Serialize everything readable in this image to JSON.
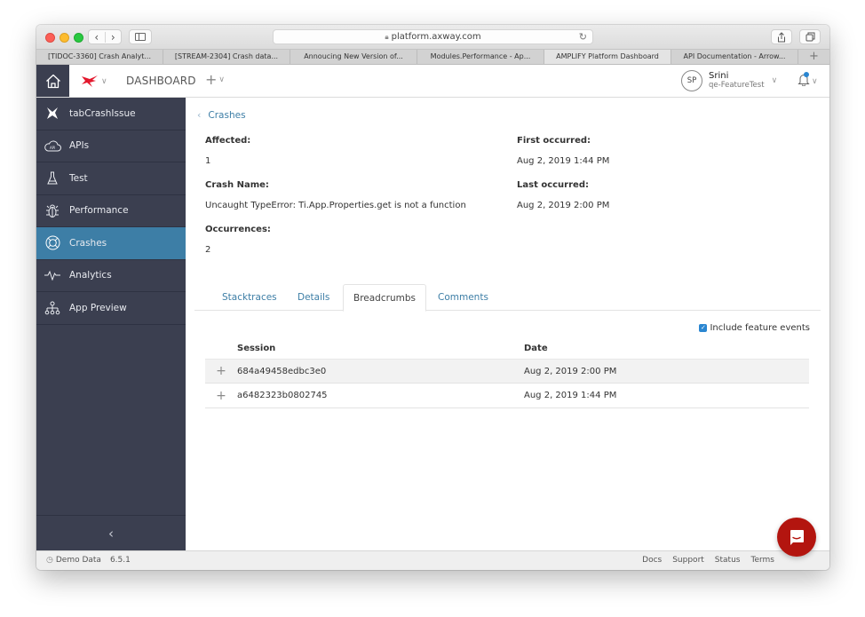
{
  "browser": {
    "url": "platform.axway.com",
    "tabs": [
      {
        "label": "[TIDOC-3360] Crash Analyt...",
        "active": false
      },
      {
        "label": "[STREAM-2304] Crash data...",
        "active": false
      },
      {
        "label": "Annoucing New Version of...",
        "active": false
      },
      {
        "label": "Modules.Performance - Ap...",
        "active": false
      },
      {
        "label": "AMPLIFY Platform Dashboard",
        "active": true
      },
      {
        "label": "API Documentation - Arrow...",
        "active": false
      }
    ],
    "new_tab_label": "+"
  },
  "header": {
    "dashboard_label": "DASHBOARD",
    "add_label": "+",
    "user": {
      "initials": "SP",
      "name": "Srini",
      "org": "qe-FeatureTest"
    },
    "notification_dot_color": "#2a86d1"
  },
  "sidebar": {
    "app_name": "tabCrashIssue",
    "items": [
      {
        "label": "APIs",
        "icon": "cloud-api-icon",
        "active": false
      },
      {
        "label": "Test",
        "icon": "flask-icon",
        "active": false
      },
      {
        "label": "Performance",
        "icon": "bug-icon",
        "active": false
      },
      {
        "label": "Crashes",
        "icon": "lifebuoy-icon",
        "active": true
      },
      {
        "label": "Analytics",
        "icon": "pulse-icon",
        "active": false
      },
      {
        "label": "App Preview",
        "icon": "hierarchy-icon",
        "active": false
      }
    ],
    "collapse_label": "‹",
    "active_color": "#3d7ea6"
  },
  "main": {
    "back_label": "Crashes",
    "fields": {
      "affected_label": "Affected:",
      "affected_value": "1",
      "crash_name_label": "Crash Name:",
      "crash_name_value": "Uncaught TypeError: Ti.App.Properties.get is not a function",
      "occurrences_label": "Occurrences:",
      "occurrences_value": "2",
      "first_occurred_label": "First occurred:",
      "first_occurred_value": "Aug 2, 2019 1:44 PM",
      "last_occurred_label": "Last occurred:",
      "last_occurred_value": "Aug 2, 2019 2:00 PM"
    },
    "tabs": [
      {
        "label": "Stacktraces",
        "active": false
      },
      {
        "label": "Details",
        "active": false
      },
      {
        "label": "Breadcrumbs",
        "active": true
      },
      {
        "label": "Comments",
        "active": false
      }
    ],
    "include_feature_events": {
      "label": "Include feature events",
      "checked": true
    },
    "table": {
      "columns": [
        "Session",
        "Date"
      ],
      "rows": [
        {
          "session": "684a49458edbc3e0",
          "date": "Aug 2, 2019 2:00 PM"
        },
        {
          "session": "a6482323b0802745",
          "date": "Aug 2, 2019 1:44 PM"
        }
      ]
    }
  },
  "footer": {
    "demo_data_label": "Demo Data",
    "version": "6.5.1",
    "links": [
      "Docs",
      "Support",
      "Status",
      "Terms"
    ]
  }
}
